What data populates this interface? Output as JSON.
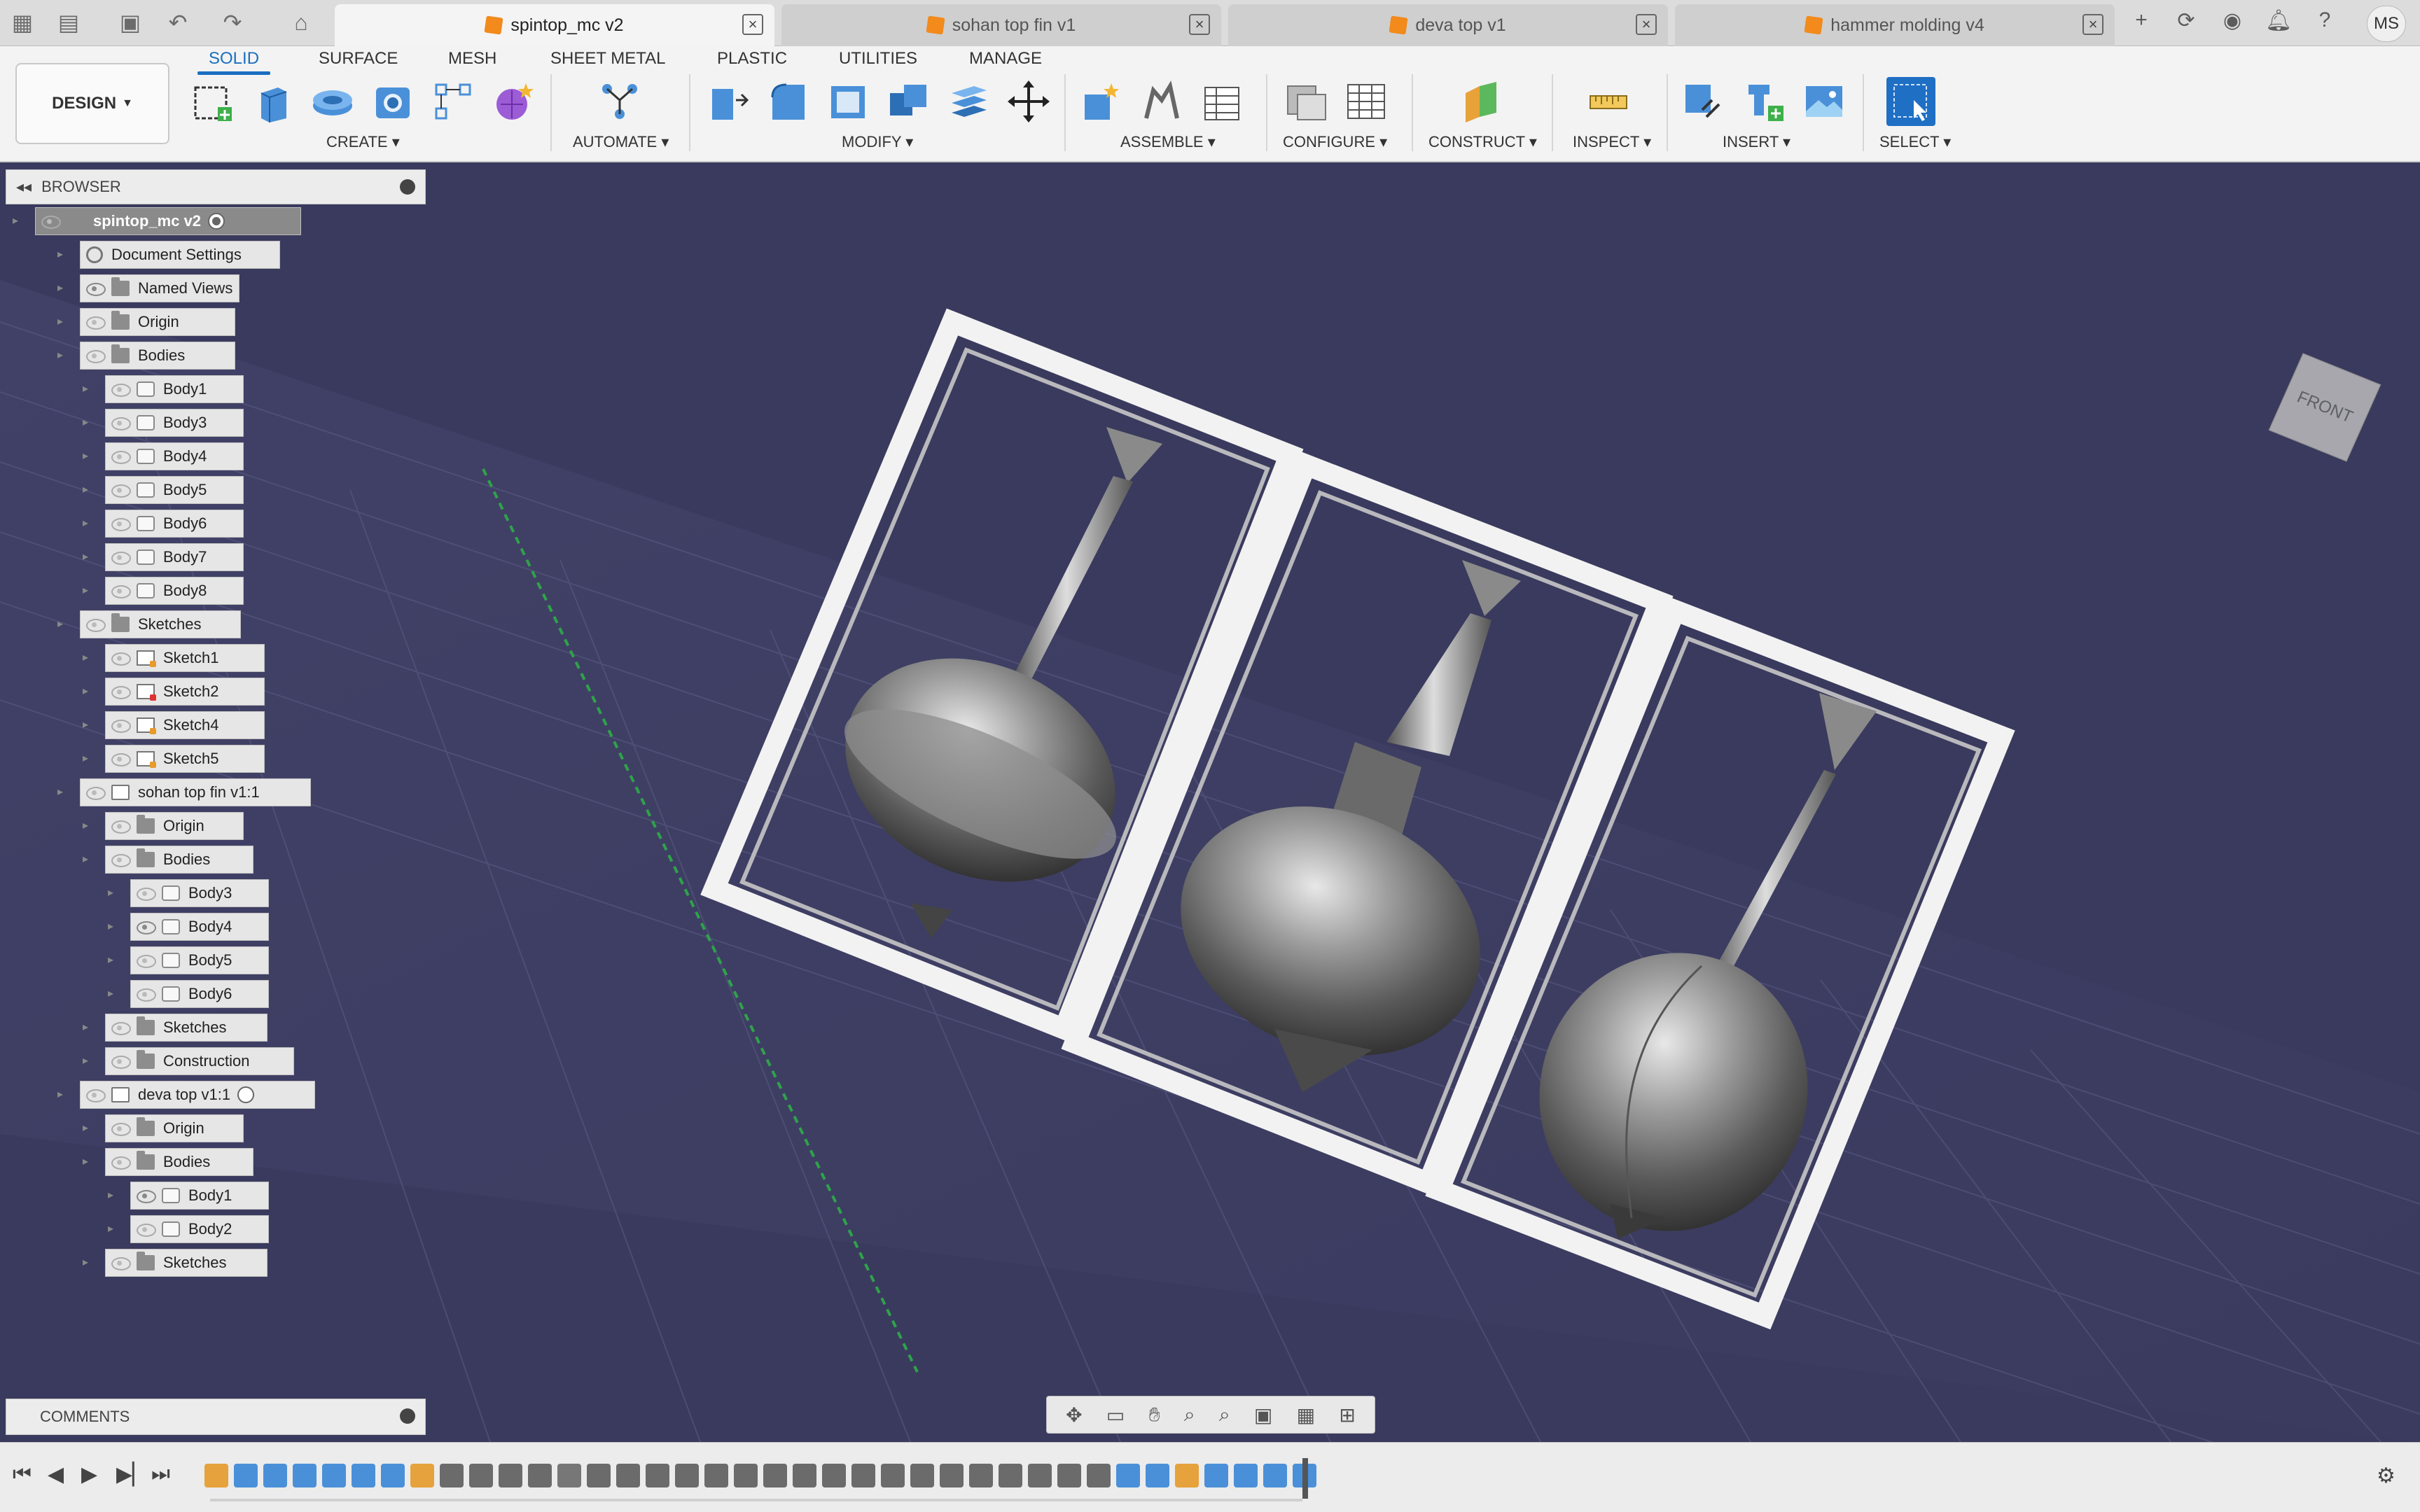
{
  "tabs": [
    {
      "label": "spintop_mc v2",
      "active": true
    },
    {
      "label": "sohan top fin v1",
      "active": false
    },
    {
      "label": "deva top v1",
      "active": false
    },
    {
      "label": "hammer molding v4",
      "active": false
    }
  ],
  "user_initials": "MS",
  "workspace": {
    "label": "DESIGN"
  },
  "ribbon": {
    "tabs": [
      "SOLID",
      "SURFACE",
      "MESH",
      "SHEET METAL",
      "PLASTIC",
      "UTILITIES",
      "MANAGE"
    ],
    "active_tab": "SOLID",
    "groups": [
      "CREATE",
      "AUTOMATE",
      "MODIFY",
      "ASSEMBLE",
      "CONFIGURE",
      "CONSTRUCT",
      "INSPECT",
      "INSERT",
      "SELECT"
    ]
  },
  "browser": {
    "title": "BROWSER",
    "nodes": [
      {
        "label": "spintop_mc v2",
        "type": "root"
      },
      {
        "label": "Document Settings",
        "type": "gear"
      },
      {
        "label": "Named Views",
        "type": "folder"
      },
      {
        "label": "Origin",
        "type": "folder"
      },
      {
        "label": "Bodies",
        "type": "folder"
      },
      {
        "label": "Body1",
        "type": "body"
      },
      {
        "label": "Body3",
        "type": "body"
      },
      {
        "label": "Body4",
        "type": "body"
      },
      {
        "label": "Body5",
        "type": "body"
      },
      {
        "label": "Body6",
        "type": "body"
      },
      {
        "label": "Body7",
        "type": "body"
      },
      {
        "label": "Body8",
        "type": "body"
      },
      {
        "label": "Sketches",
        "type": "folder"
      },
      {
        "label": "Sketch1",
        "type": "sketch"
      },
      {
        "label": "Sketch2",
        "type": "sketch-err"
      },
      {
        "label": "Sketch4",
        "type": "sketch"
      },
      {
        "label": "Sketch5",
        "type": "sketch"
      },
      {
        "label": "sohan top fin v1:1",
        "type": "component"
      },
      {
        "label": "Origin",
        "type": "folder"
      },
      {
        "label": "Bodies",
        "type": "folder"
      },
      {
        "label": "Body3",
        "type": "body"
      },
      {
        "label": "Body4",
        "type": "body"
      },
      {
        "label": "Body5",
        "type": "body"
      },
      {
        "label": "Body6",
        "type": "body"
      },
      {
        "label": "Sketches",
        "type": "folder"
      },
      {
        "label": "Construction",
        "type": "folder"
      },
      {
        "label": "deva top v1:1",
        "type": "component"
      },
      {
        "label": "Origin",
        "type": "folder"
      },
      {
        "label": "Bodies",
        "type": "folder"
      },
      {
        "label": "Body1",
        "type": "body"
      },
      {
        "label": "Body2",
        "type": "body"
      },
      {
        "label": "Sketches",
        "type": "folder"
      }
    ]
  },
  "comments": {
    "title": "COMMENTS"
  },
  "viewcube": {
    "face": "FRONT"
  },
  "colors": {
    "viewport_bg": "#3a3a5e",
    "accent": "#1a6fc0",
    "tab_icon": "#f28a1c",
    "frame": "#f2f2f2"
  }
}
